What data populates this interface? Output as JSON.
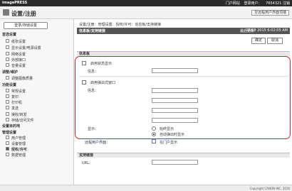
{
  "topbar": {
    "brand": "imagePRESS",
    "links": [
      "门户网站",
      "登录用户：",
      "7654321 注销"
    ]
  },
  "titlebar": {
    "title": "设置/注册",
    "mode_button": "至远程用户界面顶端"
  },
  "sidebar": {
    "register_button": "登录/存储设置",
    "items": [
      {
        "label": "首选设置",
        "type": "sec"
      },
      {
        "label": "纸张设置",
        "type": "sub"
      },
      {
        "label": "显示设置/电源设置",
        "type": "sub"
      },
      {
        "label": "网络设置",
        "type": "sub"
      },
      {
        "label": "外部接口",
        "type": "sub"
      },
      {
        "label": "音量设置",
        "type": "sub"
      },
      {
        "label": "调整/维护",
        "type": "sec"
      },
      {
        "label": "调整图像质量",
        "type": "sub"
      },
      {
        "label": "功能设置",
        "type": "sec"
      },
      {
        "label": "常规设置",
        "type": "sub"
      },
      {
        "label": "复印",
        "type": "sub"
      },
      {
        "label": "打印机",
        "type": "sub"
      },
      {
        "label": "发送",
        "type": "sub"
      },
      {
        "label": "接收/转发",
        "type": "sub"
      },
      {
        "label": "存储/访问文件",
        "type": "sub"
      },
      {
        "label": "设置目的地",
        "type": "sec"
      },
      {
        "label": "管理设置",
        "type": "sec"
      },
      {
        "label": "用户管理",
        "type": "sub"
      },
      {
        "label": "设备管理",
        "type": "sub"
      },
      {
        "label": "授权/许可",
        "type": "sub",
        "active": true
      },
      {
        "label": "数据管理",
        "type": "sub"
      }
    ]
  },
  "main": {
    "breadcrumb": "设置/注册：管理设置：授权/许可：信息板/支持链接",
    "last_update": "最后更新时间：08/18 2015 6:02:05 AM",
    "header_title": "信息板/支持链接",
    "status_label": "最后更新",
    "datetime": "08/18 2015 6:02:05 AM",
    "ok": "确定",
    "cancel": "取消",
    "section1": "信息板",
    "show_status_label": "启用状态显示",
    "message_label": "信息：",
    "show_popup_label": "启用弹出式窗口",
    "message2_label": "信息：",
    "display_label": "显示：",
    "radio_opt1": "始终显示",
    "radio_opt2": "自动弹出时显示",
    "remote_label": "远程用户界面：",
    "remote_checkbox": "在门户显示",
    "section2": "支持链接",
    "url_label": "URL："
  },
  "footer": {
    "copyright": "Copyright CANON INC. 2016"
  }
}
